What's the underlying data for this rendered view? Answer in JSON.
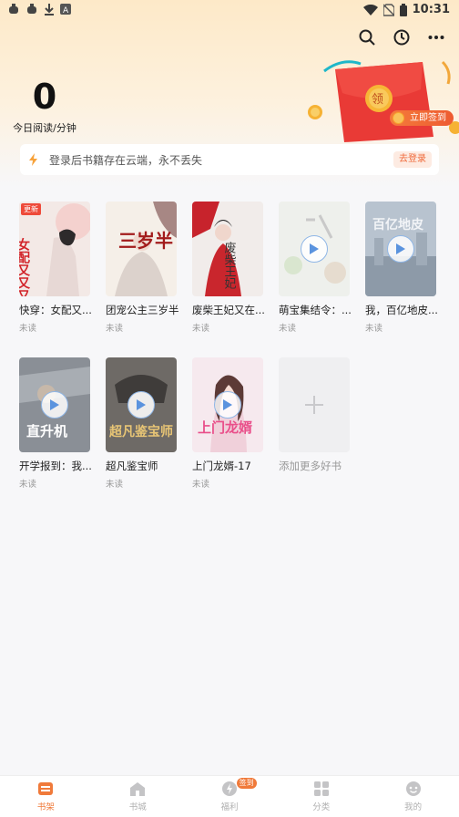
{
  "status_bar": {
    "time": "10:31"
  },
  "reading": {
    "minutes": "0",
    "label": "今日阅读/分钟"
  },
  "promo": {
    "packet_char": "领",
    "checkin_label": "立即签到"
  },
  "login_bar": {
    "message": "登录后书籍存在云端，永不丢失",
    "button": "去登录"
  },
  "books": [
    {
      "title": "快穿：女配又...",
      "status": "未读",
      "badge": "更新",
      "cover_text": "女配又又又",
      "audio": false
    },
    {
      "title": "团宠公主三岁半",
      "status": "未读",
      "cover_text": "三岁半",
      "audio": false
    },
    {
      "title": "废柴王妃又在...",
      "status": "未读",
      "cover_text": "废柴王妃",
      "audio": false
    },
    {
      "title": "萌宝集结令：...",
      "status": "未读",
      "audio": true
    },
    {
      "title": "我，百亿地皮...",
      "status": "未读",
      "cover_text": "百亿地皮",
      "audio": true
    },
    {
      "title": "开学报到：我...",
      "status": "未读",
      "cover_text": "直升机",
      "audio": true
    },
    {
      "title": "超凡鉴宝师",
      "status": "未读",
      "cover_text": "超凡鉴宝师",
      "audio": true
    },
    {
      "title": "上门龙婿-17",
      "status": "未读",
      "cover_text": "上门龙婿",
      "audio": true
    }
  ],
  "add_more": {
    "label": "添加更多好书"
  },
  "tabs": [
    {
      "label": "书架",
      "icon": "bookshelf-icon",
      "active": true
    },
    {
      "label": "书城",
      "icon": "store-icon"
    },
    {
      "label": "福利",
      "icon": "welfare-icon",
      "badge": "签到"
    },
    {
      "label": "分类",
      "icon": "category-icon"
    },
    {
      "label": "我的",
      "icon": "profile-icon"
    }
  ],
  "colors": {
    "accent": "#f07a3a",
    "hero_top": "#fde9c8",
    "background": "#f7f7f9"
  }
}
